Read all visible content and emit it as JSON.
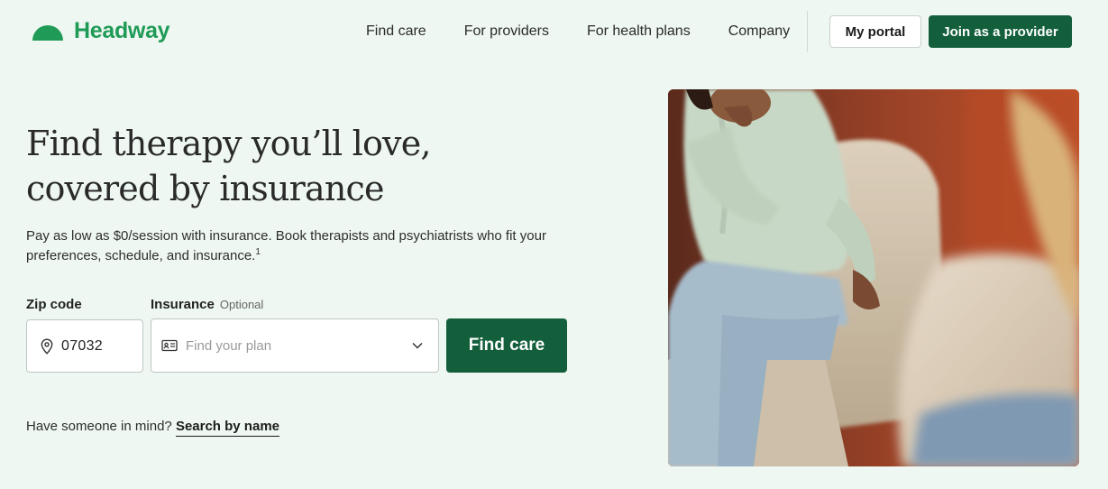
{
  "brand": {
    "name": "Headway",
    "color": "#1f9b57",
    "accent_dark": "#135f3b"
  },
  "nav": {
    "links": [
      "Find care",
      "For providers",
      "For health plans",
      "Company"
    ],
    "portal_label": "My portal",
    "join_label": "Join as a provider"
  },
  "hero": {
    "title_line1": "Find therapy you’ll love,",
    "title_line2": "covered by insurance",
    "subtitle": "Pay as low as $0/session with insurance. Book therapists and psychiatrists who fit your preferences, schedule, and insurance.",
    "footnote": "1"
  },
  "form": {
    "zip_label": "Zip code",
    "zip_value": "07032",
    "insurance_label": "Insurance",
    "insurance_optional": "Optional",
    "insurance_placeholder": "Find your plan",
    "submit_label": "Find care"
  },
  "alt_search": {
    "prompt": "Have someone in mind?",
    "link_label": "Search by name"
  },
  "icons": {
    "zip": "location-pin-icon",
    "insurance": "insurance-card-icon",
    "dropdown": "chevron-down-icon"
  }
}
